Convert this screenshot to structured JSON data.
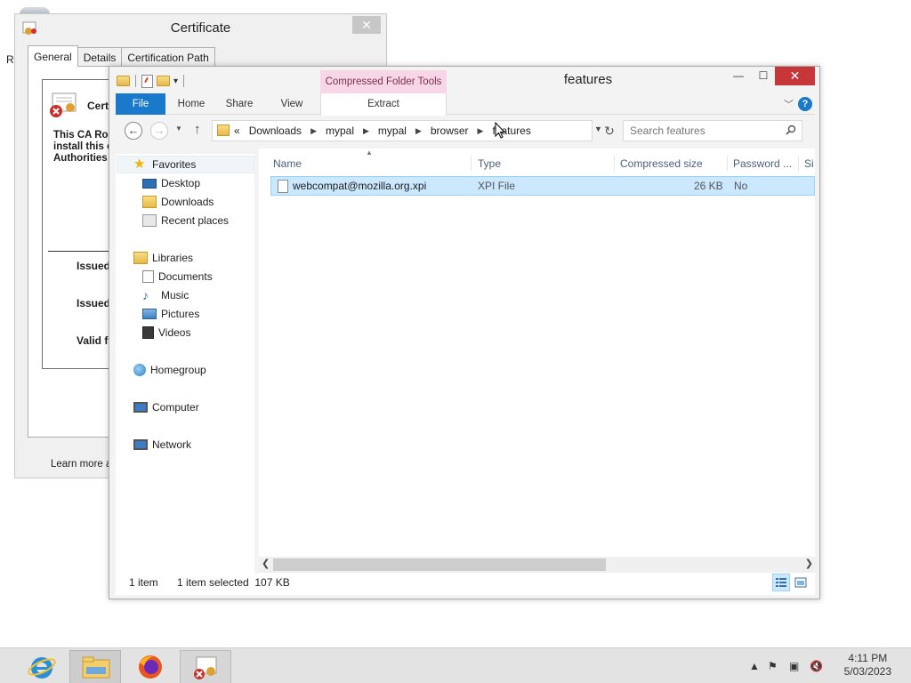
{
  "certificate_window": {
    "title": "Certificate",
    "close_glyph": "✕",
    "tabs": [
      "General",
      "Details",
      "Certification Path"
    ],
    "info_title": "Certi",
    "description_lines": [
      "This CA Roo",
      "install this c",
      "Authorities"
    ],
    "fields": [
      "Issued",
      "Issued",
      "Valid fr"
    ],
    "learn_more": "Learn more abou"
  },
  "explorer": {
    "window_title": "features",
    "contextual_tab_group": "Compressed Folder Tools",
    "window_buttons": {
      "minimize": "—",
      "maximize": "☐",
      "close": "✕"
    },
    "ribbon_tabs": {
      "file": "File",
      "home": "Home",
      "share": "Share",
      "view": "View",
      "extract": "Extract"
    },
    "help_glyph": "?",
    "address": {
      "overflow": "«",
      "crumbs": [
        "Downloads",
        "mypal",
        "mypal",
        "browser",
        "features"
      ]
    },
    "search": {
      "placeholder": "Search features"
    },
    "nav_pane": {
      "favorites": "Favorites",
      "favorites_items": [
        "Desktop",
        "Downloads",
        "Recent places"
      ],
      "libraries": "Libraries",
      "libraries_items": [
        "Documents",
        "Music",
        "Pictures",
        "Videos"
      ],
      "homegroup": "Homegroup",
      "computer": "Computer",
      "network": "Network"
    },
    "columns": {
      "name": "Name",
      "type": "Type",
      "compressed_size": "Compressed size",
      "password": "Password ...",
      "size": "Si"
    },
    "files": [
      {
        "name": "webcompat@mozilla.org.xpi",
        "type": "XPI File",
        "compressed_size": "26 KB",
        "password": "No"
      }
    ],
    "status": {
      "count": "1 item",
      "selection": "1 item selected  107 KB"
    }
  },
  "taskbar": {
    "items": [
      "internet-explorer",
      "file-explorer",
      "firefox",
      "certificate"
    ],
    "clock_time": "4:11 PM",
    "clock_date": "5/03/2023"
  },
  "colors": {
    "accent": "#1979ca",
    "selection": "#cce8ff",
    "contextual": "#f6d6e7",
    "close": "#c7373a"
  }
}
